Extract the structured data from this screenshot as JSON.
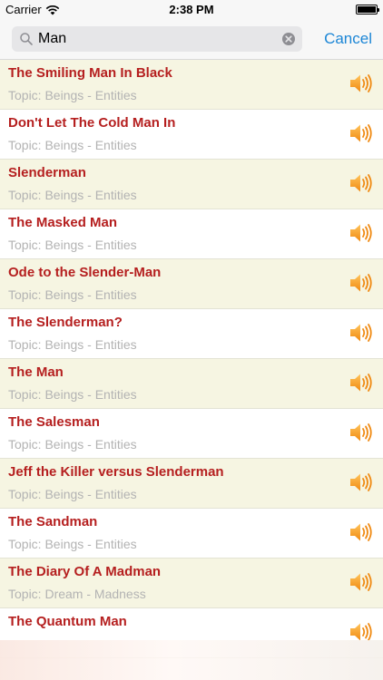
{
  "status_bar": {
    "carrier": "Carrier",
    "time": "2:38 PM",
    "battery_level": 1.0
  },
  "search": {
    "value": "Man",
    "cancel_label": "Cancel"
  },
  "colors": {
    "title": "#b51f1f",
    "subtitle": "#b3b3b3",
    "alt_row": "#f6f5e2",
    "accent": "#1c86d6",
    "speaker": "#f59a1b"
  },
  "results": [
    {
      "title": "The Smiling Man In Black",
      "topic": "Topic: Beings - Entities",
      "icon": "speaker-icon"
    },
    {
      "title": "Don't Let The Cold Man In",
      "topic": "Topic: Beings - Entities",
      "icon": "speaker-icon"
    },
    {
      "title": "Slenderman",
      "topic": "Topic: Beings - Entities",
      "icon": "speaker-icon"
    },
    {
      "title": "The Masked Man",
      "topic": "Topic: Beings - Entities",
      "icon": "speaker-icon"
    },
    {
      "title": "Ode to the Slender-Man",
      "topic": "Topic: Beings - Entities",
      "icon": "speaker-icon"
    },
    {
      "title": "The Slenderman?",
      "topic": "Topic: Beings - Entities",
      "icon": "speaker-icon"
    },
    {
      "title": "The Man",
      "topic": "Topic: Beings - Entities",
      "icon": "speaker-icon"
    },
    {
      "title": "The Salesman",
      "topic": "Topic: Beings - Entities",
      "icon": "speaker-icon"
    },
    {
      "title": "Jeff the Killer versus Slenderman",
      "topic": "Topic: Beings - Entities",
      "icon": "speaker-icon"
    },
    {
      "title": "The Sandman",
      "topic": "Topic: Beings - Entities",
      "icon": "speaker-icon"
    },
    {
      "title": "The Diary Of A Madman",
      "topic": "Topic: Dream - Madness",
      "icon": "speaker-icon"
    },
    {
      "title": "The Quantum Man",
      "topic": "",
      "icon": "speaker-icon"
    }
  ]
}
